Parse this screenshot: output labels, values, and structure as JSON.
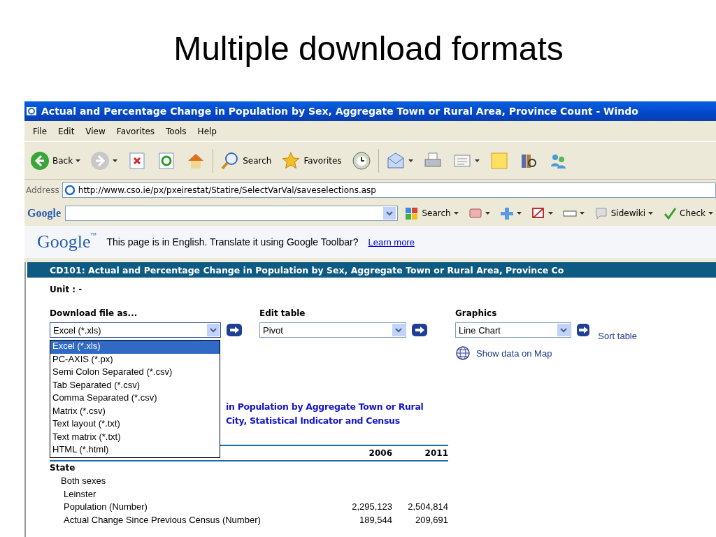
{
  "slide": {
    "title": "Multiple download formats"
  },
  "window": {
    "title": "Actual and Percentage Change in Population by Sex, Aggregate Town or Rural Area, Province Count - Windo"
  },
  "menu": [
    "File",
    "Edit",
    "View",
    "Favorites",
    "Tools",
    "Help"
  ],
  "toolbar": [
    {
      "kind": "back",
      "label": "Back"
    },
    {
      "kind": "forward"
    },
    {
      "kind": "stop"
    },
    {
      "kind": "refresh"
    },
    {
      "kind": "home"
    },
    {
      "kind": "search",
      "label": "Search"
    },
    {
      "kind": "favorites",
      "label": "Favorites"
    },
    {
      "kind": "history"
    },
    {
      "kind": "mail"
    },
    {
      "kind": "print"
    },
    {
      "kind": "edit"
    },
    {
      "kind": "note"
    },
    {
      "kind": "research"
    },
    {
      "kind": "messenger"
    }
  ],
  "address": {
    "label": "Address",
    "url": "http://www.cso.ie/px/pxeirestat/Statire/SelectVarVal/saveselections.asp"
  },
  "google_toolbar": {
    "logo": "Google",
    "items": [
      {
        "kind": "search",
        "label": "Search"
      },
      {
        "kind": "bookmark"
      },
      {
        "kind": "plus"
      },
      {
        "kind": "popup"
      },
      {
        "kind": "field"
      },
      {
        "kind": "sidewiki",
        "label": "Sidewiki"
      },
      {
        "kind": "check",
        "label": "Check"
      }
    ]
  },
  "translate_bar": {
    "logo": "Google",
    "mark": "™",
    "message": "This page is in English.  Translate it using Google Toolbar?",
    "link": "Learn more"
  },
  "content": {
    "heading": "CD101: Actual and Percentage Change in Population by Sex, Aggregate Town or Rural Area, Province Co",
    "unit": "Unit : -",
    "controls": [
      {
        "label": "Download file as...",
        "value": "Excel (*.xls)",
        "expanded": true
      },
      {
        "label": "Edit table",
        "value": "Pivot",
        "expanded": false
      },
      {
        "label": "Graphics",
        "value": "Line Chart",
        "expanded": false
      }
    ],
    "options": [
      {
        "label": "Excel (*.xls)",
        "selected": true
      },
      {
        "label": "PC-AXIS (*.px)",
        "selected": false
      },
      {
        "label": "Semi Colon Separated (*.csv)",
        "selected": false
      },
      {
        "label": "Tab Separated (*.csv)",
        "selected": false
      },
      {
        "label": "Comma Separated (*.csv)",
        "selected": false
      },
      {
        "label": "Matrix (*.csv)",
        "selected": false
      },
      {
        "label": "Text layout (*.txt)",
        "selected": false
      },
      {
        "label": "Text matrix (*.txt)",
        "selected": false
      },
      {
        "label": "HTML (*.html)",
        "selected": false
      }
    ],
    "map_link": "Show data on Map",
    "sort_link": "Sort table",
    "table_title": [
      "in Population by Aggregate Town or Rural",
      "City, Statistical Indicator and Census"
    ],
    "columns": [
      "2006",
      "2011"
    ],
    "rows": [
      {
        "label": "State",
        "children": [
          {
            "label": "Both sexes",
            "children": [
              {
                "label": "Leinster"
              },
              {
                "label": "Population (Number)",
                "values": [
                  "2,295,123",
                  "2,504,814"
                ]
              },
              {
                "label": "Actual Change Since Previous Census (Number)",
                "values": [
                  "189,544",
                  "209,691"
                ]
              }
            ]
          }
        ]
      }
    ]
  }
}
